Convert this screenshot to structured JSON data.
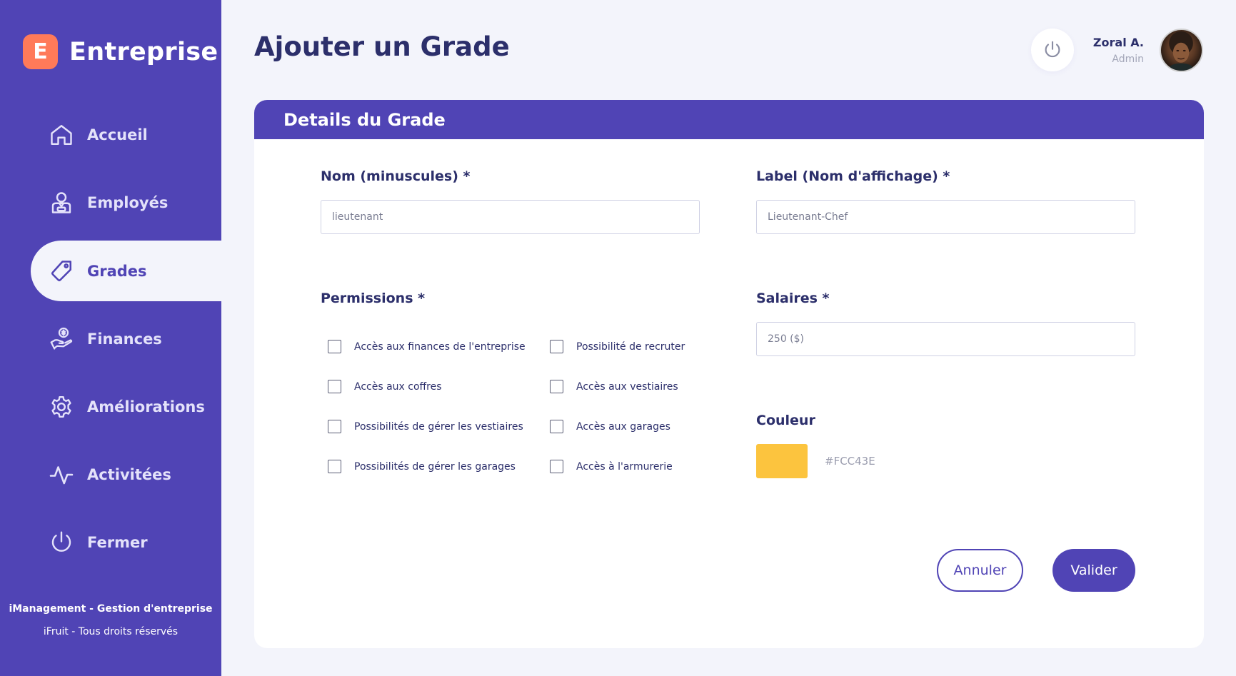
{
  "brand": {
    "logo_letter": "E",
    "name": "Entreprise",
    "logo_color": "#FF7A59"
  },
  "sidebar": {
    "bg_color": "#5044B5",
    "items": [
      {
        "label": "Accueil",
        "icon": "home-icon",
        "active": false
      },
      {
        "label": "Employés",
        "icon": "employee-icon",
        "active": false
      },
      {
        "label": "Grades",
        "icon": "tag-icon",
        "active": true
      },
      {
        "label": "Finances",
        "icon": "money-hand-icon",
        "active": false
      },
      {
        "label": "Améliorations",
        "icon": "gear-icon",
        "active": false
      },
      {
        "label": "Activitées",
        "icon": "activity-icon",
        "active": false
      },
      {
        "label": "Fermer",
        "icon": "power-icon",
        "active": false
      }
    ],
    "footer": {
      "line1": "iManagement - Gestion d'entreprise",
      "line2": "iFruit - Tous droits réservés"
    }
  },
  "header": {
    "title": "Ajouter un Grade",
    "user": {
      "name": "Zoral A.",
      "role": "Admin"
    }
  },
  "form": {
    "section_title": "Details du Grade",
    "name": {
      "label": "Nom (minuscules) *",
      "value": "lieutenant"
    },
    "display_label": {
      "label": "Label (Nom d'affichage) *",
      "value": "Lieutenant-Chef"
    },
    "permissions": {
      "label": "Permissions *",
      "items": [
        {
          "label": "Accès aux finances de l'entreprise",
          "checked": false
        },
        {
          "label": "Possibilité de recruter",
          "checked": false
        },
        {
          "label": "Accès aux coffres",
          "checked": false
        },
        {
          "label": "Accès aux vestiaires",
          "checked": false
        },
        {
          "label": "Possibilités de gérer les vestiaires",
          "checked": false
        },
        {
          "label": "Accès aux garages",
          "checked": false
        },
        {
          "label": "Possibilités de gérer les garages",
          "checked": false
        },
        {
          "label": "Accès à l'armurerie",
          "checked": false
        }
      ]
    },
    "salary": {
      "label": "Salaires *",
      "value": "250 ($)"
    },
    "color": {
      "label": "Couleur",
      "value": "#FCC43E"
    },
    "cancel_label": "Annuler",
    "submit_label": "Valider"
  }
}
